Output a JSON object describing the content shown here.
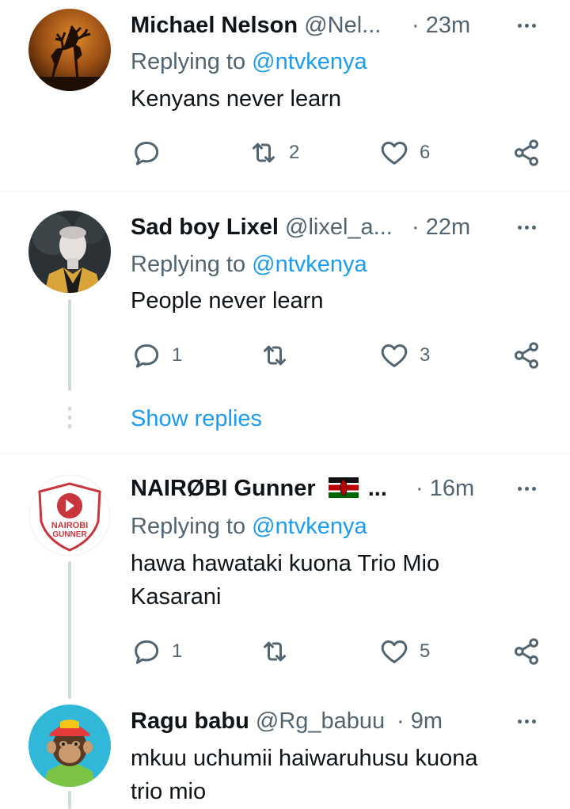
{
  "tweets": [
    {
      "name": "Michael Nelson",
      "handle": "@Nel...",
      "time": "· 23m",
      "replying_prefix": "Replying to ",
      "replying_handle": "@ntvkenya",
      "text": "Kenyans never learn",
      "reply_count": "",
      "retweet_count": "2",
      "like_count": "6",
      "avatar": "deer-silhouette"
    },
    {
      "name": "Sad boy Lixel",
      "handle": "@lixel_a...",
      "time": "· 22m",
      "replying_prefix": "Replying to ",
      "replying_handle": "@ntvkenya",
      "text": "People never learn",
      "reply_count": "1",
      "retweet_count": "",
      "like_count": "3",
      "avatar": "person-portrait"
    },
    {
      "name": "NAIRØBI Gunner",
      "handle": "...",
      "time": "· 16m",
      "replying_prefix": "Replying to ",
      "replying_handle": "@ntvkenya",
      "text_line1": "hawa hawataki kuona Trio Mio",
      "text_line2": "Kasarani",
      "reply_count": "1",
      "retweet_count": "",
      "like_count": "5",
      "avatar": "nairobi-gunner-logo",
      "flag": "kenya-flag"
    },
    {
      "name": "Ragu babu",
      "handle": "@Rg_babuu",
      "time": "· 9m",
      "text_line1": "mkuu uchumii haiwaruhusu kuona",
      "text_line2": "trio mio",
      "avatar": "monkey-cartoon"
    }
  ],
  "show_replies": "Show replies",
  "colors": {
    "link": "#1d9bf0",
    "secondary": "#536471",
    "thread_line": "#cfd9de"
  }
}
